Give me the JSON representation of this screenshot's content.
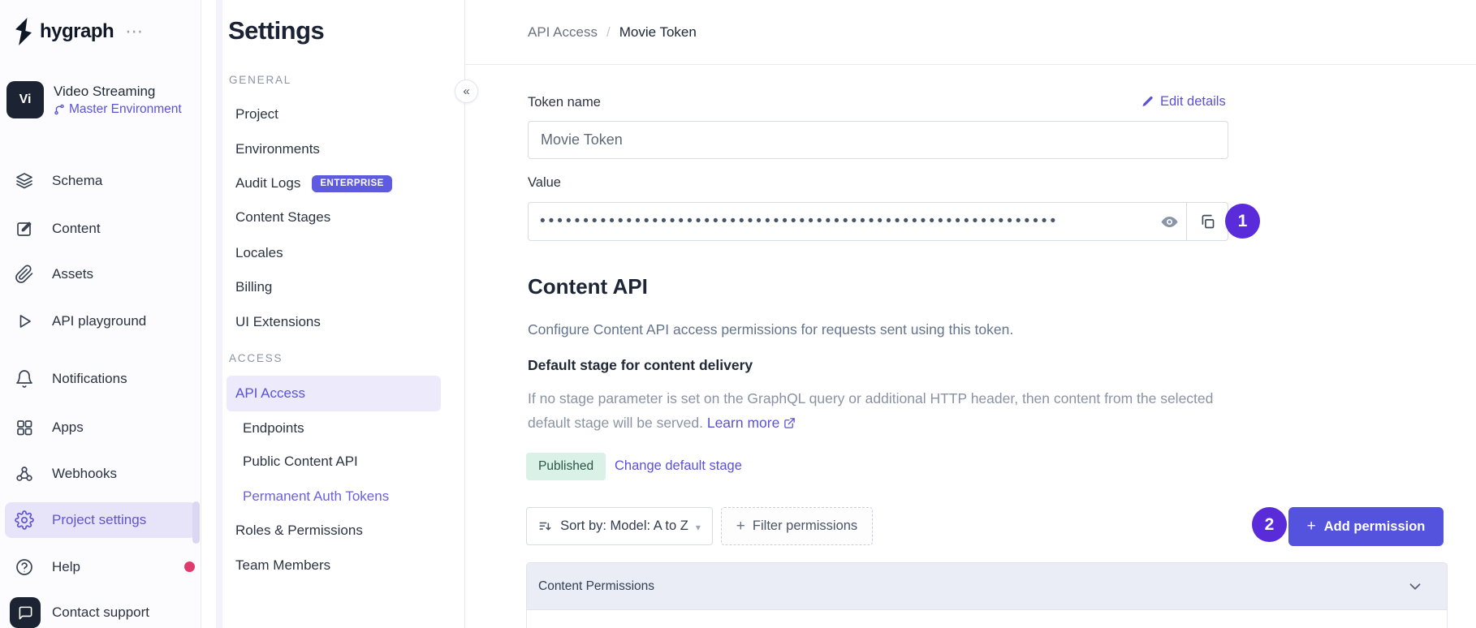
{
  "brand": {
    "name": "hygraph",
    "menu_ellipsis": "⋯"
  },
  "project": {
    "avatar_initials": "Vi",
    "name": "Video Streaming",
    "environment": "Master Environment"
  },
  "sidebar": {
    "items": [
      {
        "label": "Schema"
      },
      {
        "label": "Content"
      },
      {
        "label": "Assets"
      },
      {
        "label": "API playground"
      },
      {
        "label": "Notifications"
      },
      {
        "label": "Apps"
      },
      {
        "label": "Webhooks"
      },
      {
        "label": "Project settings",
        "active": true
      },
      {
        "label": "Help",
        "has_alert_dot": true
      },
      {
        "label": "Contact support"
      }
    ]
  },
  "settings_nav": {
    "title": "Settings",
    "collapse_glyph": "«",
    "sections": [
      {
        "label": "GENERAL",
        "items": [
          {
            "label": "Project"
          },
          {
            "label": "Environments"
          },
          {
            "label": "Audit Logs",
            "badge": "ENTERPRISE"
          },
          {
            "label": "Content Stages"
          },
          {
            "label": "Locales"
          },
          {
            "label": "Billing"
          },
          {
            "label": "UI Extensions"
          }
        ]
      },
      {
        "label": "ACCESS",
        "items": [
          {
            "label": "API Access",
            "active": true
          },
          {
            "label": "Endpoints",
            "sub": true
          },
          {
            "label": "Public Content API",
            "sub": true
          },
          {
            "label": "Permanent Auth Tokens",
            "sub": true,
            "current": true
          },
          {
            "label": "Roles & Permissions"
          },
          {
            "label": "Team Members"
          }
        ]
      }
    ]
  },
  "breadcrumb": {
    "parent": "API Access",
    "separator": "/",
    "current": "Movie Token"
  },
  "token_form": {
    "name_label": "Token name",
    "name_value": "Movie Token",
    "edit_details_label": "Edit details",
    "value_label": "Value",
    "value_masked": "••••••••••••••••••••••••••••••••••••••••••••••••••••••••••••"
  },
  "annotations": {
    "step1": "1",
    "step2": "2"
  },
  "content_api": {
    "heading": "Content API",
    "description": "Configure Content API access permissions for requests sent using this token.",
    "default_stage_heading": "Default stage for content delivery",
    "default_stage_line1": "If no stage parameter is set on the GraphQL query or additional HTTP header, then content from the selected",
    "default_stage_line2": "default stage will be served.",
    "learn_more_label": "Learn more",
    "published_badge": "Published",
    "change_default_stage_label": "Change default stage"
  },
  "permissions": {
    "sort_button_label": "Sort by: Model: A to Z",
    "sort_caret": "▾",
    "filter_plus": "+",
    "filter_button_label": "Filter permissions",
    "add_plus": "+",
    "add_permission_label": "Add permission",
    "table_header": "Content Permissions"
  },
  "colors": {
    "accent_purple": "#5a52d6",
    "annotation_purple": "#5a2bd8",
    "add_button_indigo": "#5453dd",
    "enterprise_badge": "#5e5be0",
    "active_row_bg": "#e7e4f9",
    "published_bg": "#d9f1e6",
    "published_text": "#2e544a",
    "alert_red": "#e0396d"
  }
}
